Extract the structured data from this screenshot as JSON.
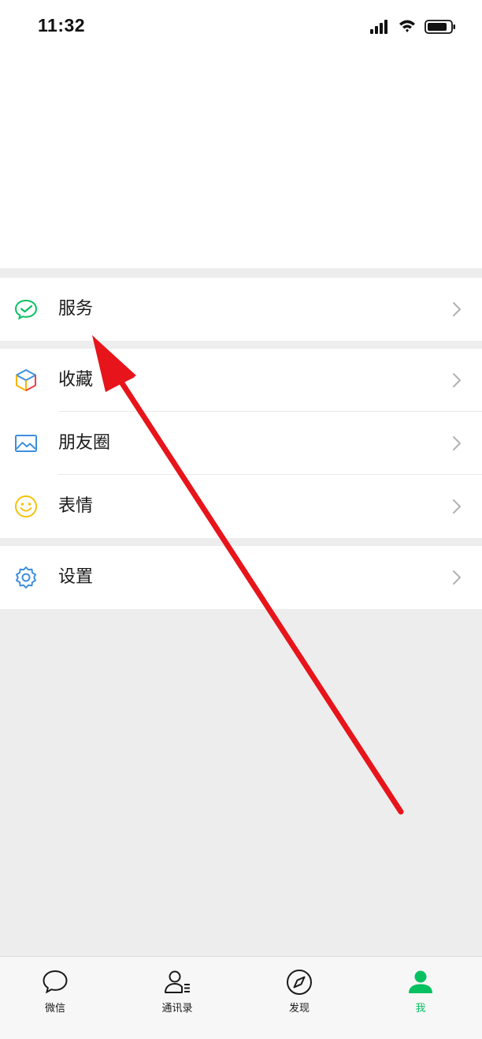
{
  "status_bar": {
    "time": "11:32"
  },
  "menu": {
    "service": "服务",
    "favorites": "收藏",
    "moments": "朋友圈",
    "stickers": "表情",
    "settings": "设置"
  },
  "tabbar": {
    "tabs": [
      {
        "label": "微信",
        "icon": "chat-bubble-icon",
        "active": false
      },
      {
        "label": "通讯录",
        "icon": "contacts-icon",
        "active": false
      },
      {
        "label": "发现",
        "icon": "compass-icon",
        "active": false
      },
      {
        "label": "我",
        "icon": "me-person-icon",
        "active": true
      }
    ],
    "active_color": "#07c160"
  },
  "colors": {
    "background": "#ededed",
    "card": "#ffffff",
    "annotation_arrow": "#e8141b"
  }
}
